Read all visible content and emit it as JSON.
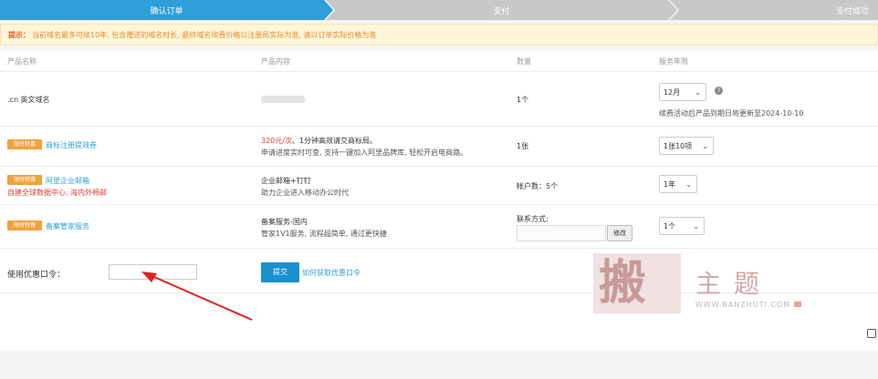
{
  "steps": [
    "确认订单",
    "支付",
    "支付成功"
  ],
  "tip": {
    "label": "提示：",
    "text": "当前域名最多可续10年, 包含赠送的域名时长, 最终域名续费价格以注册局实际为准, 请以订单实际价格为准"
  },
  "table": {
    "headers": [
      "产品名称",
      "产品内容",
      "数量",
      "服务年限"
    ],
    "rows": [
      {
        "name": ".cn 英文域名",
        "qty": "1个",
        "term": "12月",
        "note": "续费活动后产品到期日将更新至2024-10-10"
      },
      {
        "tag": "限时特惠",
        "name": "商标注册提效券",
        "price": "320元/次",
        "content1_rest": "、1分钟高效请交商标局。",
        "content2": "申请进度实时可查, 支持一键加入阿里品牌库, 轻松开启电商路。",
        "qty": "1张",
        "term": "1张10项"
      },
      {
        "tag": "限时特惠",
        "name": "阿里企业邮箱",
        "subname": "自建全球数据中心, 海内外畅邮",
        "content1": "企业邮箱+钉钉",
        "content2": "助力企业进入移动办公时代",
        "qty": "帐户数：5个",
        "term": "1年"
      },
      {
        "tag": "限时特惠",
        "name": "备案管家服务",
        "content1": "备案服务-国内",
        "content2": "管家1V1服务, 流程超简单, 通过更快捷",
        "contact_label": "联系方式:",
        "modify": "修改",
        "term": "1个"
      }
    ]
  },
  "coupon": {
    "label": "使用优惠口令：",
    "submit": "提交",
    "link": "如何获取优惠口令"
  },
  "watermark": {
    "big": "搬",
    "chars": "主题",
    "url": "WWW.BANZHUTI.COM"
  },
  "colors": {
    "accent": "#2e9fd8",
    "tag": "#f0a23c",
    "tip_bg": "#fff5d9",
    "tip_text": "#e68a2e"
  }
}
